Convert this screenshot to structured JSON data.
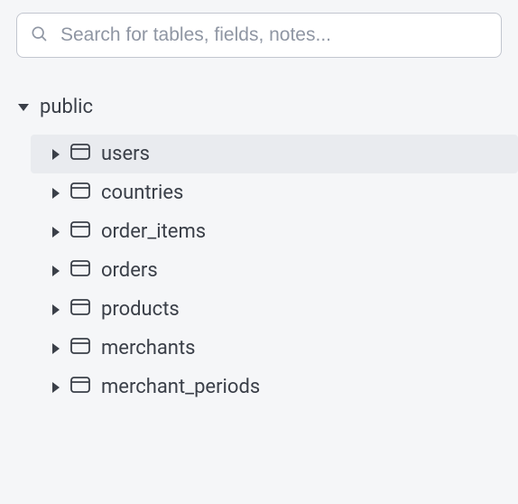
{
  "search": {
    "placeholder": "Search for tables, fields, notes...",
    "value": ""
  },
  "tree": {
    "schema": {
      "name": "public",
      "expanded": true,
      "tables": [
        {
          "name": "users",
          "selected": true
        },
        {
          "name": "countries",
          "selected": false
        },
        {
          "name": "order_items",
          "selected": false
        },
        {
          "name": "orders",
          "selected": false
        },
        {
          "name": "products",
          "selected": false
        },
        {
          "name": "merchants",
          "selected": false
        },
        {
          "name": "merchant_periods",
          "selected": false
        }
      ]
    }
  }
}
